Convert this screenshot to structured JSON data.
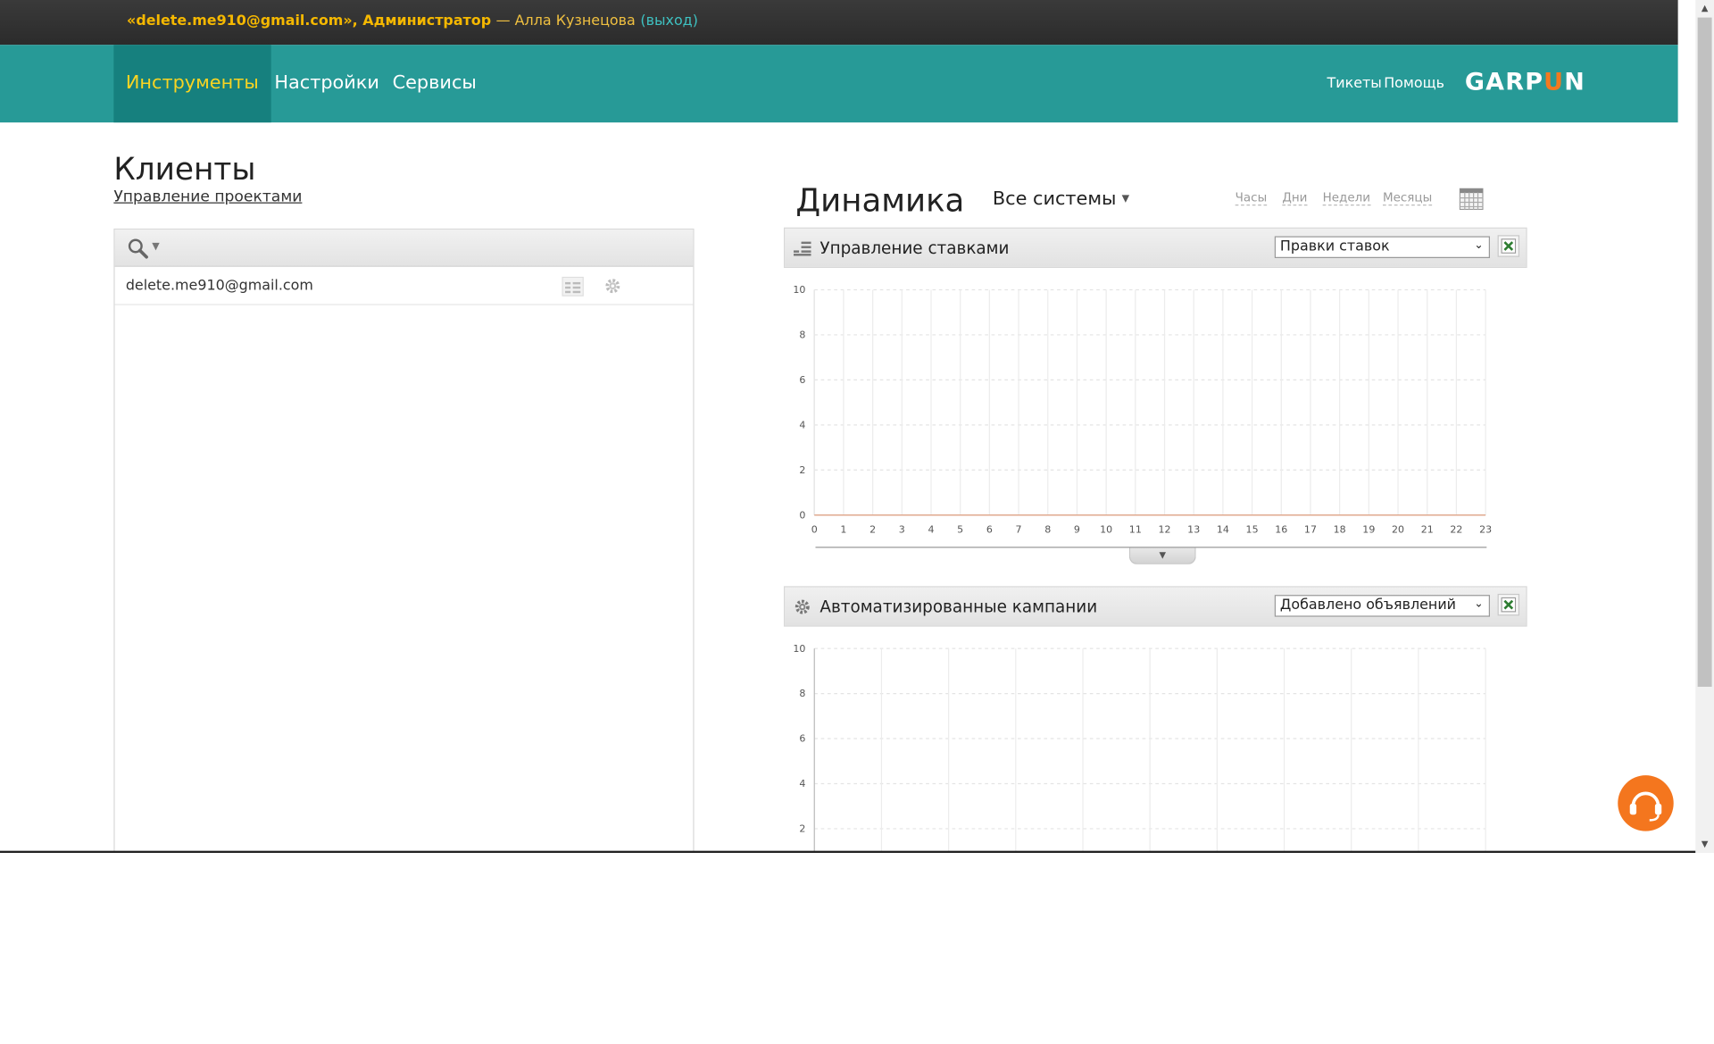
{
  "topbar": {
    "account": "«delete.me910@gmail.com», Администратор",
    "user": "— Алла Кузнецова",
    "logout": "(выход)"
  },
  "nav": {
    "items": [
      {
        "label": "Инструменты",
        "active": true
      },
      {
        "label": "Настройки",
        "active": false
      },
      {
        "label": "Сервисы",
        "active": false
      }
    ],
    "right": [
      {
        "label": "Тикеты"
      },
      {
        "label": "Помощь"
      }
    ],
    "logo": "GARPUN"
  },
  "clients": {
    "title": "Клиенты",
    "projects_link": "Управление проектами",
    "rows": [
      {
        "email": "delete.me910@gmail.com"
      }
    ]
  },
  "dynamics": {
    "title": "Динамика",
    "systems": "Все системы",
    "periods": [
      "Часы",
      "Дни",
      "Недели",
      "Месяцы"
    ]
  },
  "panels": [
    {
      "title": "Управление ставками",
      "select": "Правки ставок",
      "icon": "bars-icon"
    },
    {
      "title": "Автоматизированные кампании",
      "select": "Добавлено объявлений",
      "icon": "gear-icon"
    }
  ],
  "chart_data": [
    {
      "type": "line",
      "x": [
        0,
        1,
        2,
        3,
        4,
        5,
        6,
        7,
        8,
        9,
        10,
        11,
        12,
        13,
        14,
        15,
        16,
        17,
        18,
        19,
        20,
        21,
        22,
        23
      ],
      "series": [
        {
          "values": [
            0,
            0,
            0,
            0,
            0,
            0,
            0,
            0,
            0,
            0,
            0,
            0,
            0,
            0,
            0,
            0,
            0,
            0,
            0,
            0,
            0,
            0,
            0,
            0
          ]
        }
      ],
      "yticks": [
        0,
        2,
        4,
        6,
        8,
        10
      ],
      "ylim": [
        0,
        10
      ],
      "grid": true,
      "title": "",
      "xlabel": "",
      "ylabel": ""
    },
    {
      "type": "line",
      "x": [],
      "series": [],
      "yticks": [
        2,
        4,
        6,
        8,
        10
      ],
      "ylim": [
        0,
        10
      ],
      "grid": true,
      "title": "",
      "xlabel": "",
      "ylabel": ""
    }
  ],
  "colors": {
    "topbar": "#2f2f2f",
    "navbar": "#279a97",
    "nav_active": "#16807e",
    "accent_yellow": "#f9d422",
    "support": "#f4761e",
    "series_line": "#e0a98f"
  }
}
